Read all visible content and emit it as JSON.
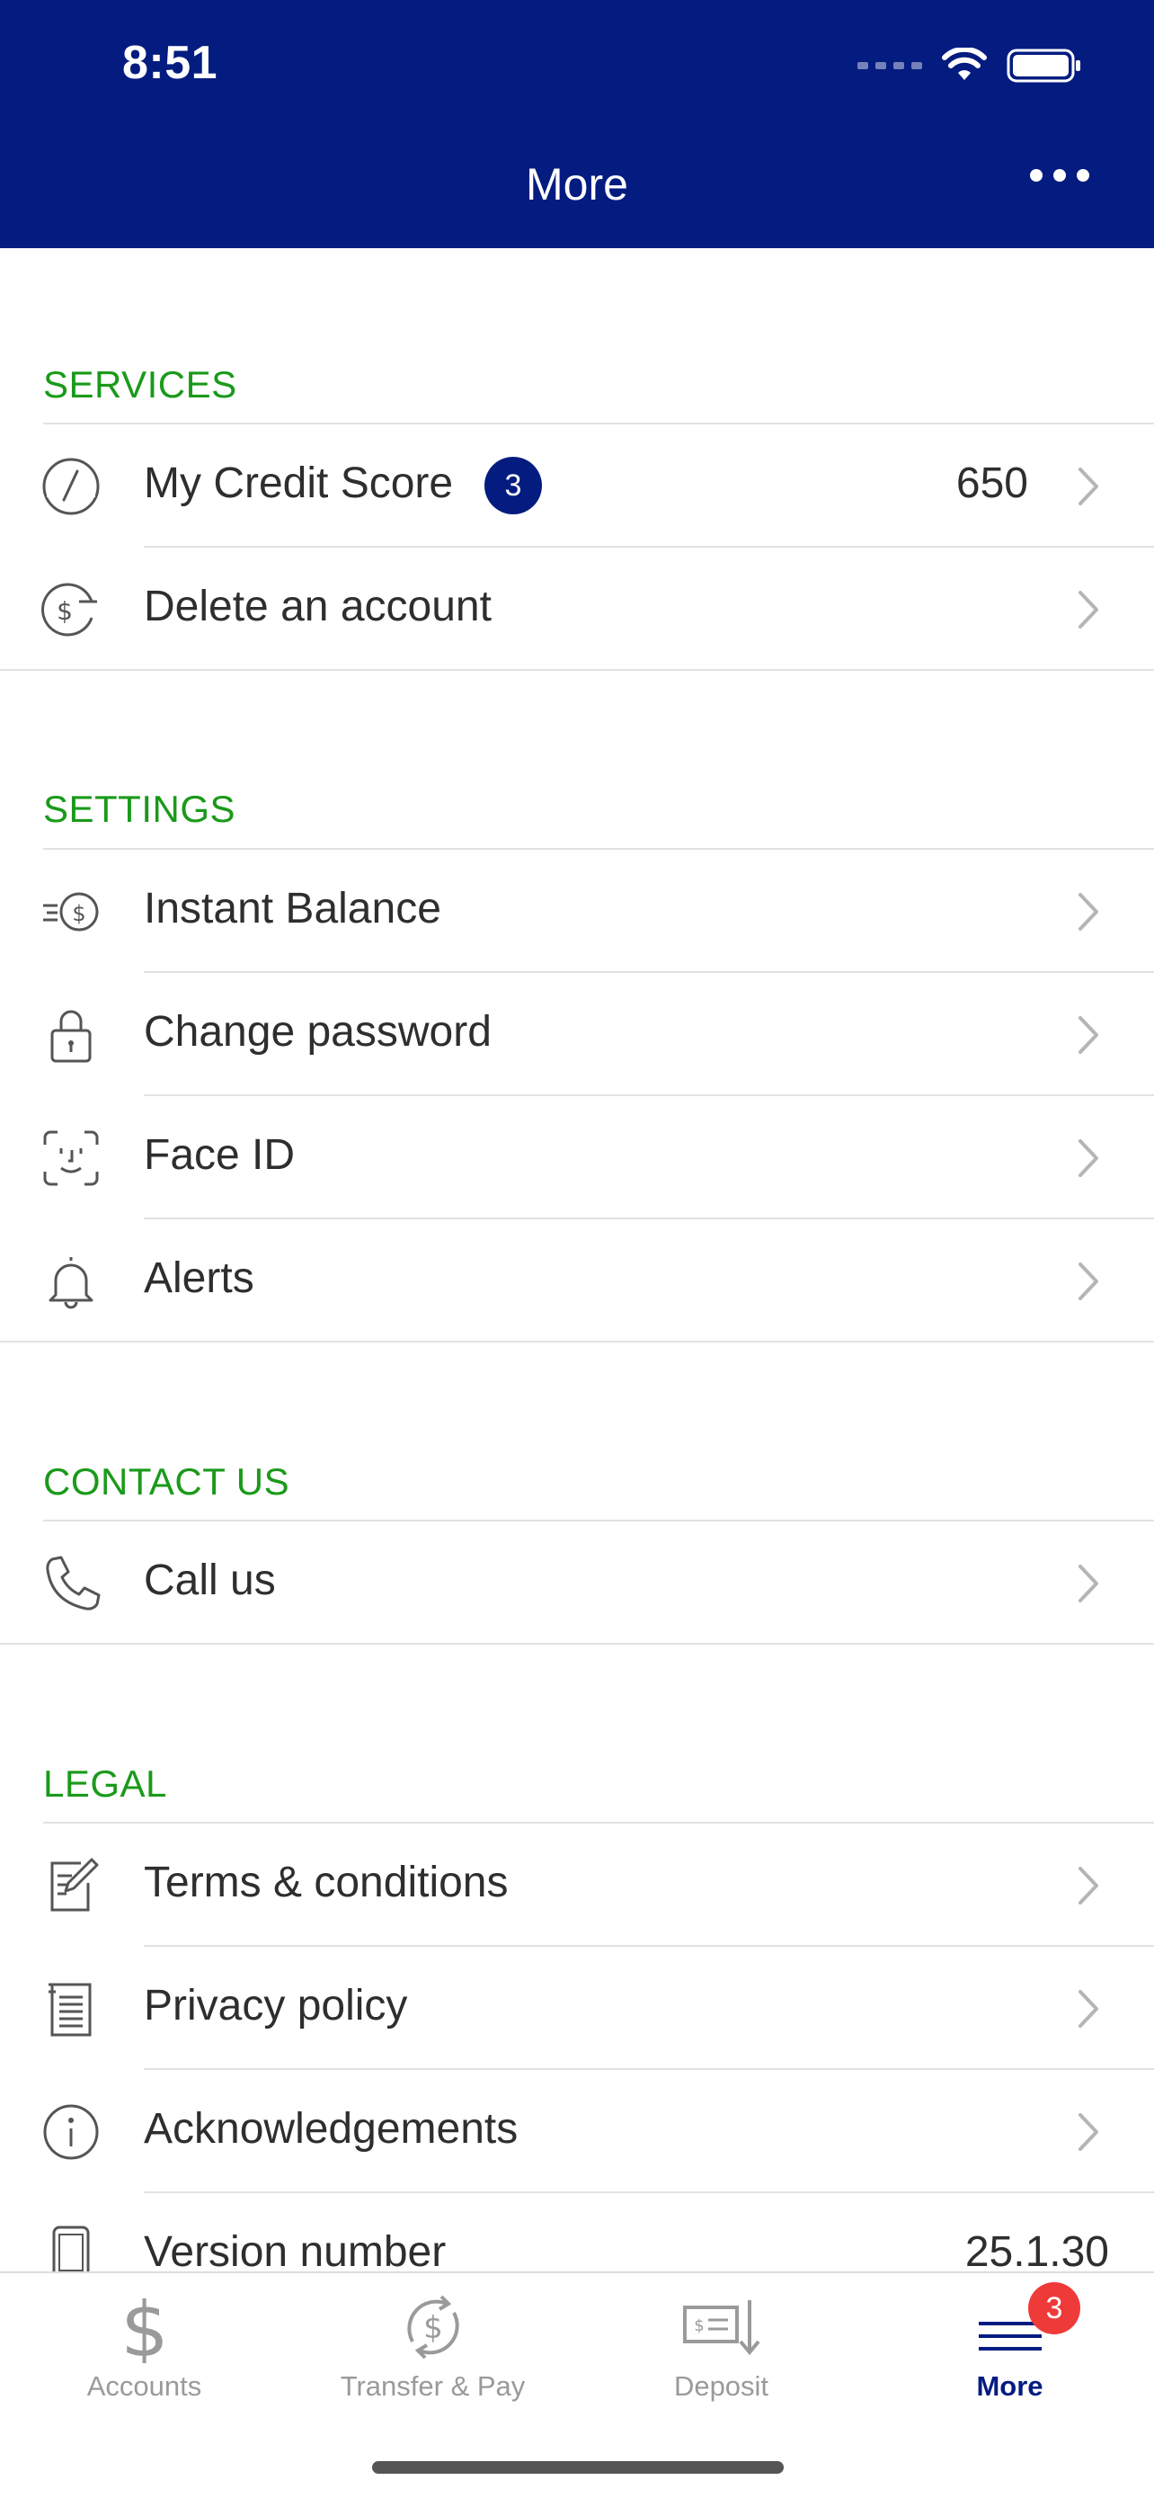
{
  "status_bar": {
    "time": "8:51"
  },
  "header": {
    "title": "More"
  },
  "sections": {
    "services": {
      "title": "SERVICES",
      "items": [
        {
          "label": "My Credit Score",
          "badge": "3",
          "value": "650",
          "icon": "gauge-icon"
        },
        {
          "label": "Delete an account",
          "icon": "dollar-minus-icon"
        }
      ]
    },
    "settings": {
      "title": "SETTINGS",
      "items": [
        {
          "label": "Instant Balance",
          "icon": "fast-dollar-icon"
        },
        {
          "label": "Change password",
          "icon": "lock-icon"
        },
        {
          "label": "Face ID",
          "icon": "face-id-icon"
        },
        {
          "label": "Alerts",
          "icon": "bell-icon"
        }
      ]
    },
    "contact": {
      "title": "CONTACT US",
      "items": [
        {
          "label": "Call us",
          "icon": "phone-icon"
        }
      ]
    },
    "legal": {
      "title": "LEGAL",
      "items": [
        {
          "label": "Terms & conditions",
          "icon": "document-pen-icon"
        },
        {
          "label": "Privacy policy",
          "icon": "document-icon"
        },
        {
          "label": "Acknowledgements",
          "icon": "info-icon"
        },
        {
          "label": "Version number",
          "value": "25.1.30",
          "icon": "mobile-phone-icon"
        }
      ]
    }
  },
  "tabbar": {
    "tabs": [
      {
        "label": "Accounts",
        "icon": "dollar-icon"
      },
      {
        "label": "Transfer & Pay",
        "icon": "transfer-icon"
      },
      {
        "label": "Deposit",
        "icon": "check-deposit-icon"
      },
      {
        "label": "More",
        "icon": "menu-icon",
        "badge": "3",
        "active": true
      }
    ]
  },
  "colors": {
    "header_bg": "#041c80",
    "section_title": "#1a9a1a",
    "tab_badge": "#ef3a3a"
  }
}
